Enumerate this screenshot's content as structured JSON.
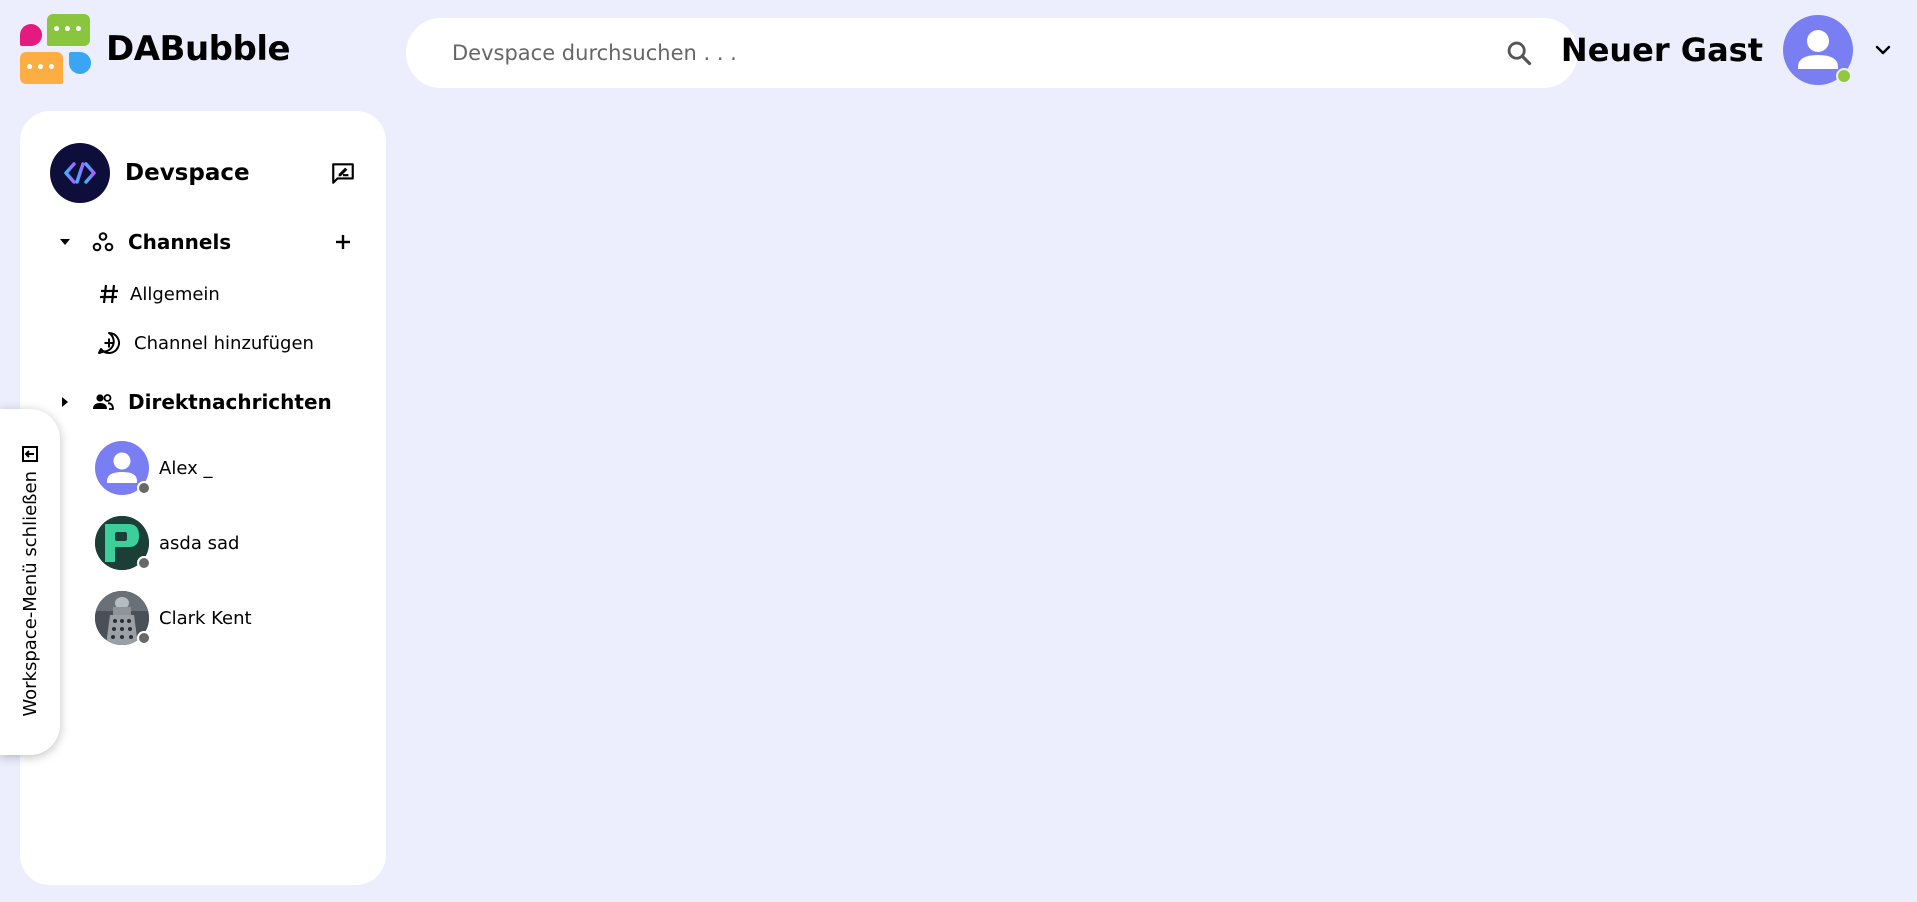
{
  "app": {
    "name": "DABubble"
  },
  "search": {
    "placeholder": "Devspace durchsuchen . . ."
  },
  "user": {
    "name": "Neuer Gast",
    "status": "online"
  },
  "workspace": {
    "name": "Devspace"
  },
  "channels": {
    "label": "Channels",
    "items": [
      {
        "label": "Allgemein",
        "icon": "hash-icon"
      }
    ],
    "add_label": "Channel hinzufügen"
  },
  "direct_messages": {
    "label": "Direktnachrichten",
    "users": [
      {
        "name": "Alex _",
        "status": "offline",
        "avatar": "default-person"
      },
      {
        "name": "asda sad",
        "status": "offline",
        "avatar": "green-logo"
      },
      {
        "name": "Clark Kent",
        "status": "offline",
        "avatar": "robot-photo"
      }
    ]
  },
  "toggle": {
    "label": "Workspace-Menü schließen"
  },
  "colors": {
    "background": "#eceefe",
    "accent": "#797ef3",
    "online": "#92c83e",
    "offline": "#686868"
  }
}
